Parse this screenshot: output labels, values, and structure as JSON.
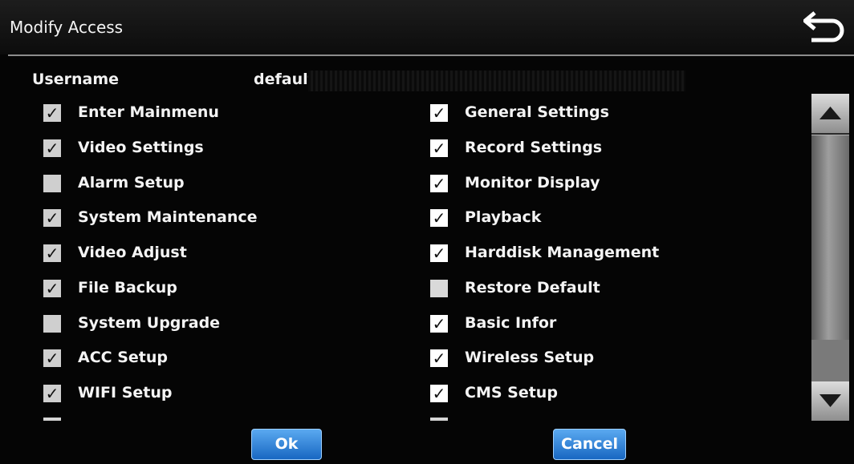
{
  "header": {
    "title": "Modify Access"
  },
  "user": {
    "label": "Username",
    "value": "default"
  },
  "permissions_left": [
    {
      "label": "Enter Mainmenu",
      "checked": true
    },
    {
      "label": "Video Settings",
      "checked": true
    },
    {
      "label": "Alarm Setup",
      "checked": false
    },
    {
      "label": "System Maintenance",
      "checked": true
    },
    {
      "label": "Video Adjust",
      "checked": true
    },
    {
      "label": "File Backup",
      "checked": true
    },
    {
      "label": "System Upgrade",
      "checked": false
    },
    {
      "label": "ACC Setup",
      "checked": true
    },
    {
      "label": "WIFI Setup",
      "checked": true
    }
  ],
  "permissions_right": [
    {
      "label": "General Settings",
      "checked": true
    },
    {
      "label": "Record Settings",
      "checked": true
    },
    {
      "label": "Monitor Display",
      "checked": true
    },
    {
      "label": "Playback",
      "checked": true
    },
    {
      "label": "Harddisk Management",
      "checked": true
    },
    {
      "label": "Restore Default",
      "checked": false
    },
    {
      "label": "Basic Infor",
      "checked": true
    },
    {
      "label": "Wireless Setup",
      "checked": true
    },
    {
      "label": "CMS Setup",
      "checked": true
    }
  ],
  "check_glyph": "✓",
  "buttons": {
    "ok": "Ok",
    "cancel": "Cancel"
  },
  "colors": {
    "button_blue": "#1867c2",
    "background": "#050505"
  },
  "icons": {
    "back": "back-arrow-icon",
    "up": "scroll-up-icon",
    "down": "scroll-down-icon"
  }
}
